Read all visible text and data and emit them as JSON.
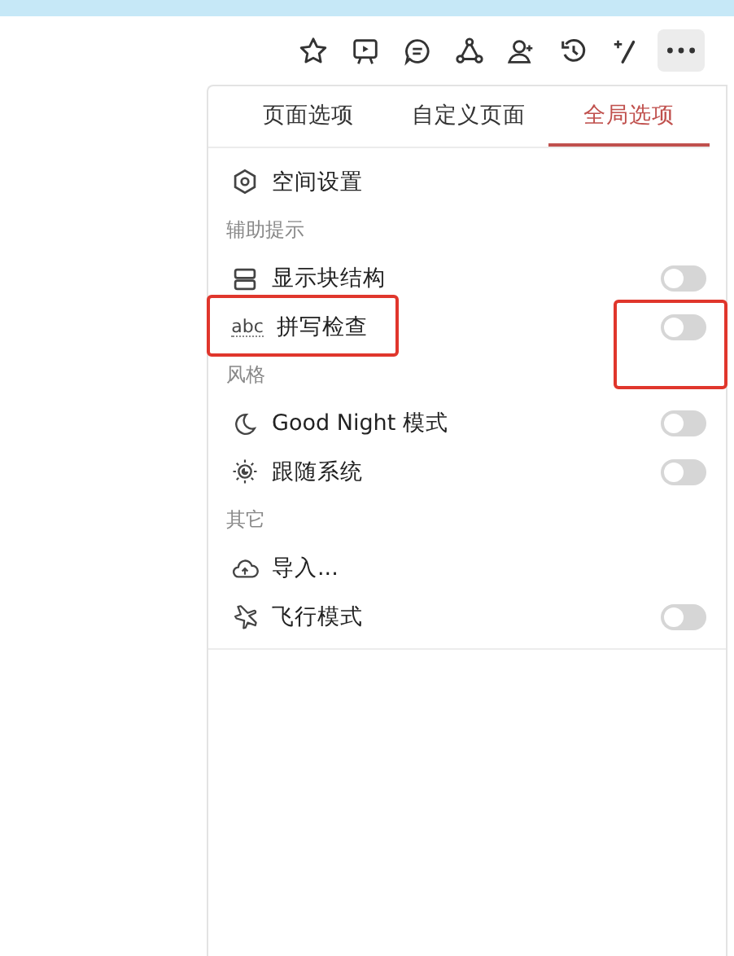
{
  "toolbar": {
    "buttons": [
      {
        "selected": false
      },
      {
        "selected": false
      },
      {
        "selected": false
      },
      {
        "selected": false
      },
      {
        "selected": false
      },
      {
        "selected": false
      },
      {
        "selected": false
      },
      {
        "selected": true
      }
    ]
  },
  "menu": {
    "tabs": [
      {
        "label": "页面选项",
        "selected": false
      },
      {
        "label": "自定义页面",
        "selected": false
      },
      {
        "label": "全局选项",
        "selected": true
      }
    ],
    "items": [
      {
        "kind": "link",
        "label": "空间设置"
      },
      {
        "kind": "header",
        "label": "辅助提示"
      },
      {
        "kind": "toggle",
        "label": "显示块结构",
        "on": false,
        "highlighted": false
      },
      {
        "kind": "toggle",
        "icon_text": "abc",
        "label": "拼写检查",
        "on": false,
        "highlighted": true
      },
      {
        "kind": "header",
        "label": "风格"
      },
      {
        "kind": "toggle",
        "label": "Good Night 模式",
        "on": false,
        "highlighted": false
      },
      {
        "kind": "toggle",
        "label": "跟随系统",
        "on": false,
        "highlighted": false
      },
      {
        "kind": "header",
        "label": "其它"
      },
      {
        "kind": "link",
        "label": "导入..."
      },
      {
        "kind": "toggle",
        "label": "飞行模式",
        "on": false,
        "highlighted": false
      }
    ]
  }
}
